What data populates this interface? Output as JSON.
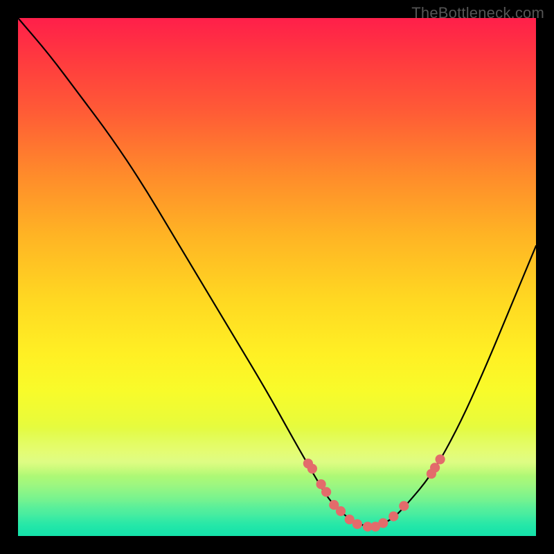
{
  "watermark": "TheBottleneck.com",
  "chart_data": {
    "type": "line",
    "title": "",
    "xlabel": "",
    "ylabel": "",
    "xlim": [
      0,
      100
    ],
    "ylim": [
      0,
      100
    ],
    "grid": false,
    "legend": false,
    "series": [
      {
        "name": "bottleneck-curve",
        "color": "#000000",
        "x": [
          0,
          6,
          12,
          18,
          24,
          30,
          36,
          42,
          48,
          53,
          57,
          60,
          63,
          66,
          69,
          72,
          75,
          80,
          85,
          90,
          95,
          100
        ],
        "y": [
          100,
          93,
          85,
          77,
          68,
          58,
          48,
          38,
          28,
          19,
          12,
          7,
          4,
          2,
          2,
          3,
          6,
          12,
          21,
          32,
          44,
          56
        ]
      }
    ],
    "highlight_points": {
      "name": "sample-dots",
      "color": "#e36b6b",
      "radius_pct": 0.95,
      "x": [
        56.0,
        56.8,
        58.5,
        59.5,
        61.0,
        62.3,
        64.0,
        65.5,
        67.5,
        69.0,
        70.5,
        72.5,
        74.5,
        79.8,
        80.5,
        81.5
      ],
      "y": [
        14.0,
        13.0,
        10.0,
        8.5,
        6.0,
        4.8,
        3.2,
        2.3,
        1.8,
        1.8,
        2.5,
        3.8,
        5.8,
        12.0,
        13.2,
        14.8
      ]
    },
    "background_gradient": {
      "top": "#ff1f4a",
      "mid": "#ffe324",
      "bottom": "#19e7a8"
    }
  }
}
